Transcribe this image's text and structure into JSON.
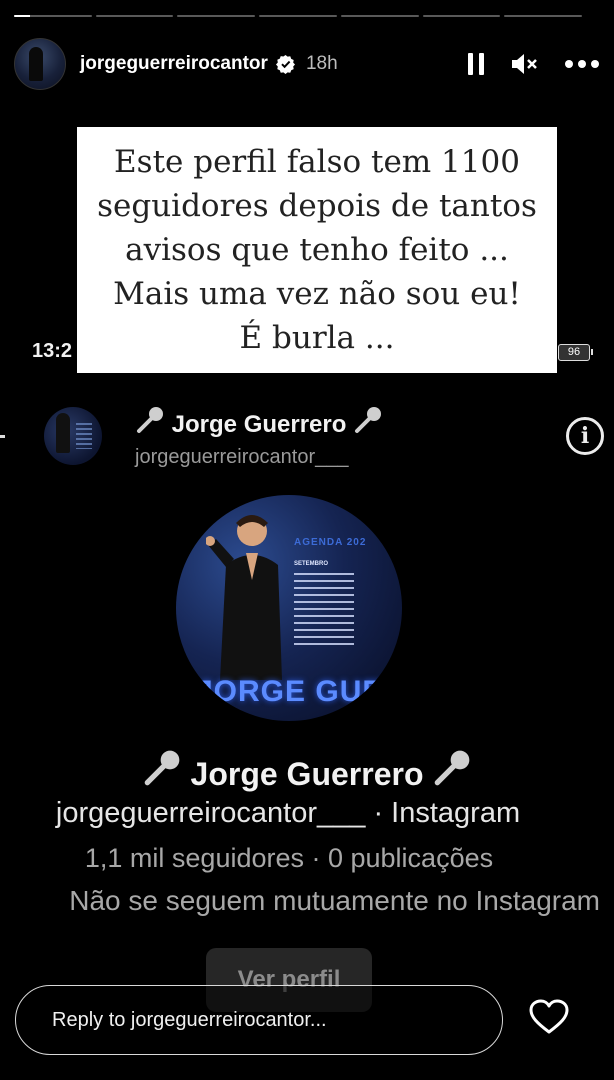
{
  "story": {
    "segments_total": 7,
    "current_segment": 1,
    "current_segment_progress": 0.2
  },
  "header": {
    "username": "jorgeguerreirocantor",
    "time_ago": "18h",
    "icons": [
      "verified-badge-icon",
      "pause-icon",
      "mute-icon",
      "more-options-icon"
    ]
  },
  "overlay_note": {
    "lines": [
      "Este perfil falso tem 1100",
      "seguidores depois de tantos",
      "avisos que tenho feito ...",
      "Mais uma vez  não sou eu!",
      "É burla ..."
    ]
  },
  "screenshot_status": {
    "clock": "13:2",
    "battery": "96"
  },
  "fake_profile_header": {
    "display_name": "Jorge Guerrero",
    "handle": "jorgeguerreirocantor___",
    "icons": [
      "microphone-icon",
      "info-icon"
    ]
  },
  "fake_profile_card": {
    "picture_texts": {
      "agenda_title": "AGENDA 202",
      "agenda_subtitle": "SETEMBRO",
      "brand": "JORGE GUERRE"
    },
    "display_name": "Jorge Guerrero",
    "handle_platform": "jorgeguerreirocantor___ · Instagram",
    "stats": "1,1 mil seguidores · 0 publicações",
    "mutual": "Não se seguem mutuamente no Instagram",
    "view_profile_label": "Ver perfil"
  },
  "reply": {
    "placeholder": "Reply to jorgeguerreirocantor..."
  },
  "colors": {
    "background": "#000000",
    "note_background": "#ffffff",
    "note_text": "#222222",
    "secondary_text": "#a8a8a8"
  }
}
